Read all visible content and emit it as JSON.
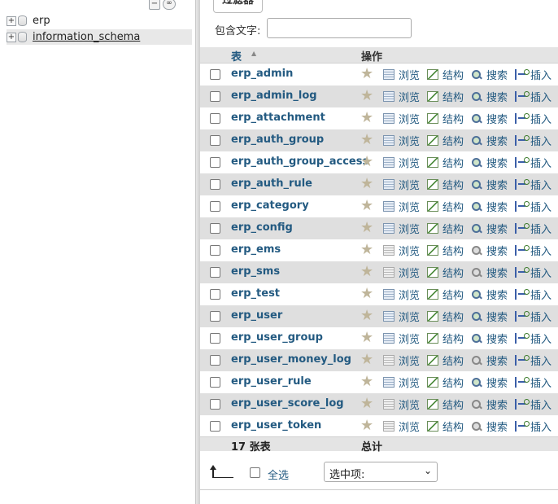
{
  "navigation": {
    "tree_controls": {
      "collapse": "−",
      "link": "∞"
    },
    "databases": [
      {
        "name": "erp",
        "expander": "+"
      },
      {
        "name": "information_schema",
        "expander": "+"
      }
    ]
  },
  "filter": {
    "legend": "过滤器",
    "label": "包含文字:",
    "value": ""
  },
  "table": {
    "header_table": "表",
    "header_ops": "操作",
    "action_labels": {
      "browse": "浏览",
      "structure": "结构",
      "search": "搜索",
      "insert": "插入"
    },
    "rows": [
      {
        "name": "erp_admin"
      },
      {
        "name": "erp_admin_log"
      },
      {
        "name": "erp_attachment"
      },
      {
        "name": "erp_auth_group"
      },
      {
        "name": "erp_auth_group_access"
      },
      {
        "name": "erp_auth_rule"
      },
      {
        "name": "erp_category"
      },
      {
        "name": "erp_config"
      },
      {
        "name": "erp_ems"
      },
      {
        "name": "erp_sms"
      },
      {
        "name": "erp_test"
      },
      {
        "name": "erp_user"
      },
      {
        "name": "erp_user_group"
      },
      {
        "name": "erp_user_money_log"
      },
      {
        "name": "erp_user_rule"
      },
      {
        "name": "erp_user_score_log"
      },
      {
        "name": "erp_user_token"
      }
    ],
    "footer_count": "17 张表",
    "footer_total": "总计"
  },
  "bulk": {
    "select_all_label": "全选",
    "with_selected": "选中项:",
    "chevron": "⌄"
  }
}
